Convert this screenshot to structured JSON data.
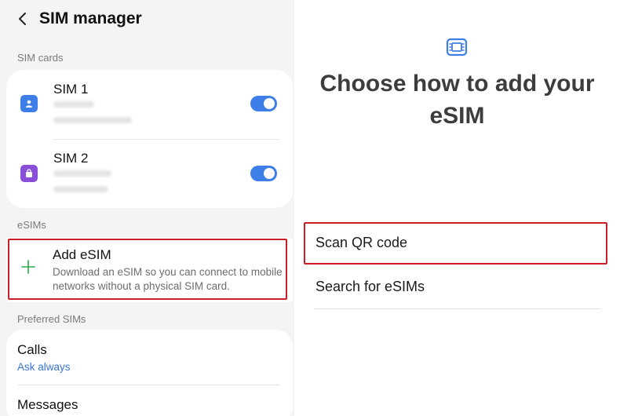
{
  "left": {
    "title": "SIM manager",
    "sections": {
      "sim_cards": "SIM cards",
      "esims": "eSIMs",
      "preferred": "Preferred SIMs"
    },
    "sims": [
      {
        "name": "SIM 1",
        "icon": "person-sim-icon",
        "color": "#3e7ee8",
        "enabled": true
      },
      {
        "name": "SIM 2",
        "icon": "bag-sim-icon",
        "color": "#8a4fd8",
        "enabled": true
      }
    ],
    "add_esim": {
      "title": "Add eSIM",
      "description": "Download an eSIM so you can connect to mobile networks without a physical SIM card."
    },
    "preferred": {
      "calls_label": "Calls",
      "calls_value": "Ask always",
      "messages_label": "Messages"
    }
  },
  "right": {
    "heading": "Choose how to add your eSIM",
    "options": [
      "Scan QR code",
      "Search for eSIMs"
    ]
  },
  "colors": {
    "accent": "#3e7ee8",
    "highlight": "#c8202a",
    "add_icon": "#2fa84f"
  }
}
